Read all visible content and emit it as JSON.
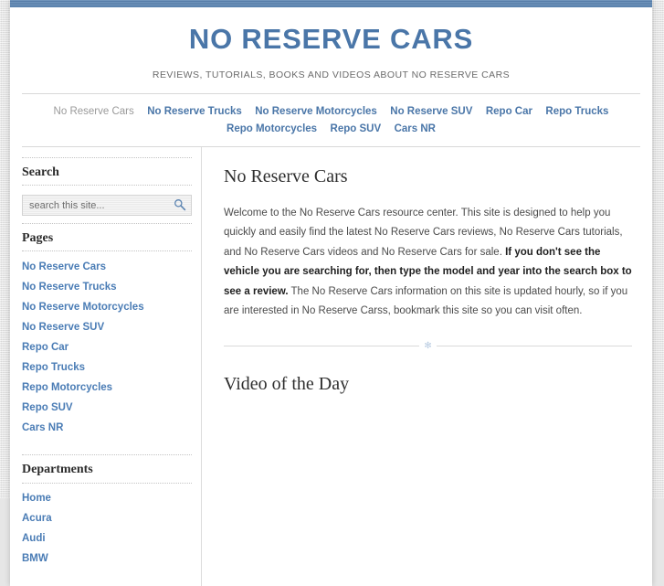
{
  "site": {
    "title": "NO RESERVE CARS",
    "tagline": "REVIEWS, TUTORIALS, BOOKS AND VIDEOS ABOUT NO RESERVE CARS",
    "accent_color": "#4a76a8",
    "link_color": "#4a7cb5",
    "top_bar_color": "#5b84b1",
    "page_background": "#dedede"
  },
  "nav": {
    "items": [
      {
        "label": "No Reserve Cars",
        "current": true
      },
      {
        "label": "No Reserve Trucks",
        "current": false
      },
      {
        "label": "No Reserve Motorcycles",
        "current": false
      },
      {
        "label": "No Reserve SUV",
        "current": false
      },
      {
        "label": "Repo Car",
        "current": false
      },
      {
        "label": "Repo Trucks",
        "current": false
      },
      {
        "label": "Repo Motorcycles",
        "current": false
      },
      {
        "label": "Repo SUV",
        "current": false
      },
      {
        "label": "Cars NR",
        "current": false
      }
    ]
  },
  "sidebar": {
    "search": {
      "title": "Search",
      "placeholder": "search this site...",
      "value": "",
      "icon": "search-icon"
    },
    "pages": {
      "title": "Pages",
      "items": [
        {
          "label": "No Reserve Cars"
        },
        {
          "label": "No Reserve Trucks"
        },
        {
          "label": "No Reserve Motorcycles"
        },
        {
          "label": "No Reserve SUV"
        },
        {
          "label": "Repo Car"
        },
        {
          "label": "Repo Trucks"
        },
        {
          "label": "Repo Motorcycles"
        },
        {
          "label": "Repo SUV"
        },
        {
          "label": "Cars NR"
        }
      ]
    },
    "departments": {
      "title": "Departments",
      "items": [
        {
          "label": "Home"
        },
        {
          "label": "Acura"
        },
        {
          "label": "Audi"
        },
        {
          "label": "BMW"
        }
      ]
    }
  },
  "main": {
    "entry_title": "No Reserve Cars",
    "paragraph": {
      "part1": "Welcome to the No Reserve Cars resource center. This site is designed to help you quickly and easily find the latest No Reserve Cars reviews, No Reserve Cars tutorials, and No Reserve Cars videos and No Reserve Cars for sale. ",
      "bold": "If you don't see the vehicle you are searching for, then type the model and year into the search box to see a review.",
      "part2": " The No Reserve Cars information on this site is updated hourly, so if you are interested in No Reserve Carss, bookmark this site so you can visit often."
    },
    "divider_ornament": "✻",
    "section_title": "Video of the Day"
  }
}
